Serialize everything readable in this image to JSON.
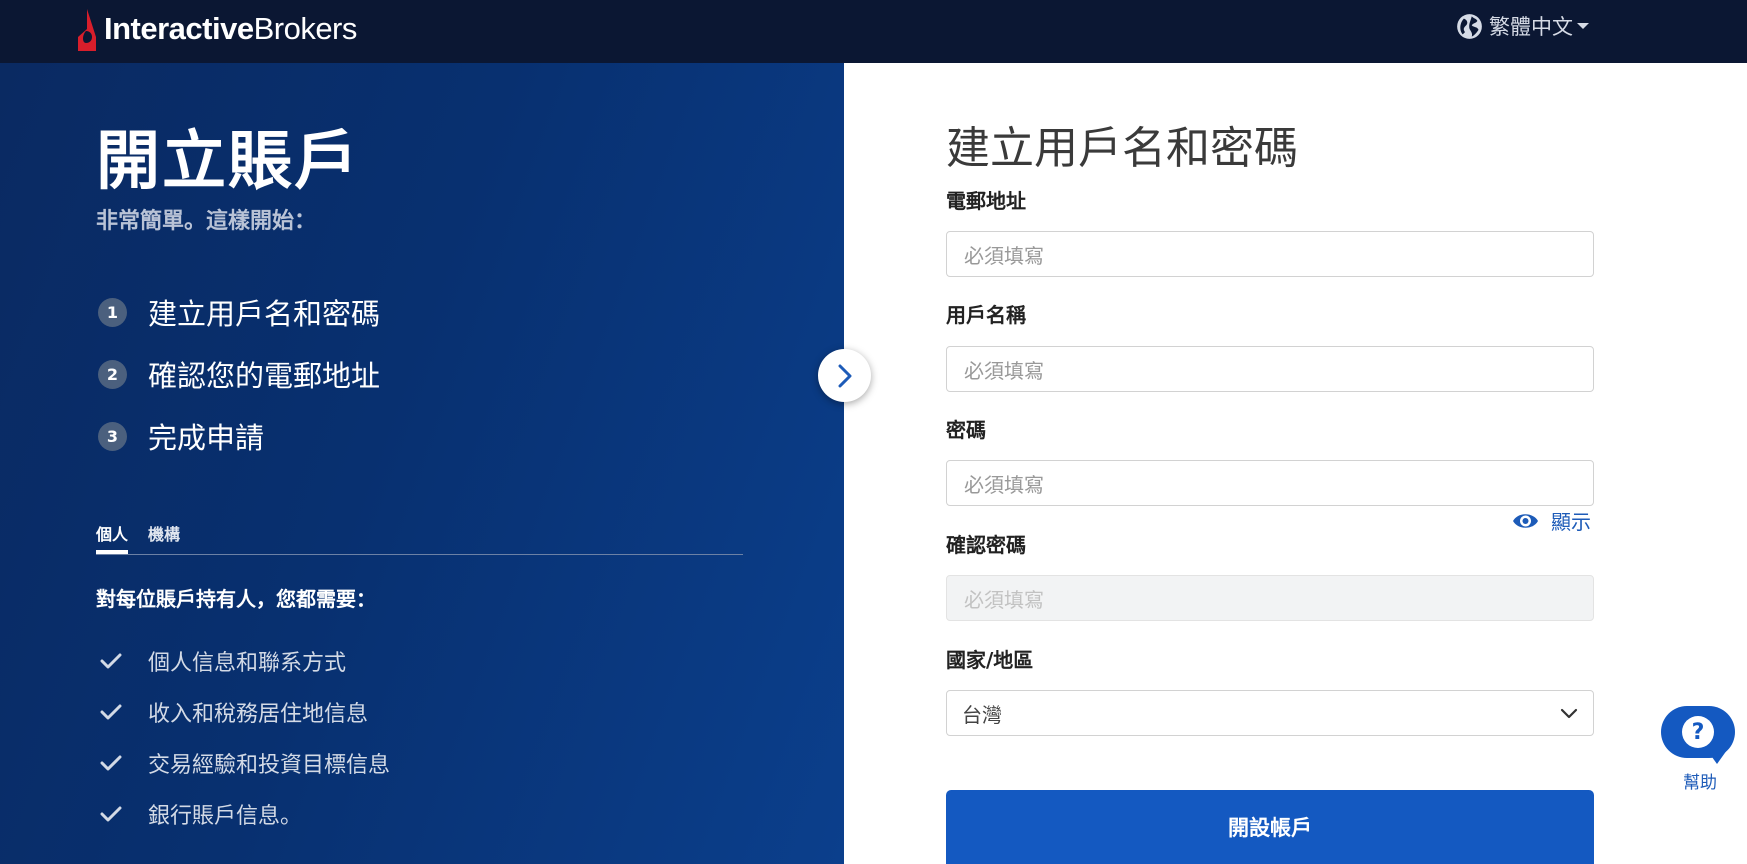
{
  "header": {
    "brand_bold": "Interactive",
    "brand_light": "Brokers",
    "language": "繁體中文",
    "colors": {
      "background": "#0b1733",
      "logo_red": "#d81e2b"
    }
  },
  "left_panel": {
    "title": "開立賬戶",
    "subtitle": "非常簡單。這樣開始：",
    "steps": [
      {
        "num": "1",
        "label": "建立用戶名和密碼"
      },
      {
        "num": "2",
        "label": "確認您的電郵地址"
      },
      {
        "num": "3",
        "label": "完成申請"
      }
    ],
    "tabs": [
      {
        "label": "個人",
        "active": true
      },
      {
        "label": "機構",
        "active": false
      }
    ],
    "requirements_title": "對每位賬戶持有人，您都需要：",
    "requirements": [
      "個人信息和聯系方式",
      "收入和稅務居住地信息",
      "交易經驗和投資目標信息",
      "銀行賬戶信息。"
    ],
    "colors": {
      "gradient_start": "#0a2a62",
      "gradient_end": "#0b3f8c"
    }
  },
  "form": {
    "title": "建立用戶名和密碼",
    "email": {
      "label": "電郵地址",
      "placeholder": "必須填寫"
    },
    "username": {
      "label": "用戶名稱",
      "placeholder": "必須填寫"
    },
    "password": {
      "label": "密碼",
      "placeholder": "必須填寫"
    },
    "show_password": "顯示",
    "confirm_password": {
      "label": "確認密碼",
      "placeholder": "必須填寫"
    },
    "country": {
      "label": "國家/地區",
      "value": "台灣"
    },
    "submit": "開設帳戶",
    "colors": {
      "primary": "#1459c1"
    }
  },
  "help": {
    "label": "幫助",
    "glyph": "?"
  },
  "icons": [
    "ib-logo-icon",
    "globe-icon",
    "chevron-right-icon",
    "check-icon",
    "eye-icon",
    "chevron-down-icon",
    "help-icon"
  ]
}
